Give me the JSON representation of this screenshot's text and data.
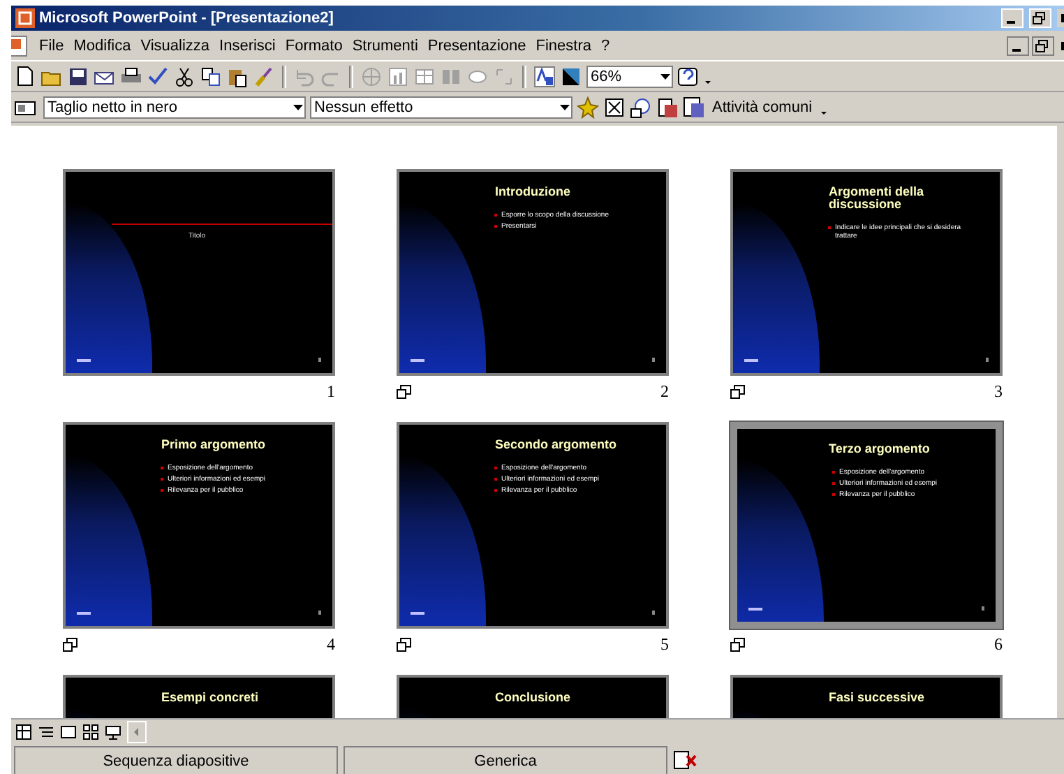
{
  "window": {
    "title": "Microsoft PowerPoint - [Presentazione2]"
  },
  "menu": [
    {
      "label": "File"
    },
    {
      "label": "Modifica"
    },
    {
      "label": "Visualizza"
    },
    {
      "label": "Inserisci"
    },
    {
      "label": "Formato"
    },
    {
      "label": "Strumenti"
    },
    {
      "label": "Presentazione"
    },
    {
      "label": "Finestra"
    },
    {
      "label": "?"
    }
  ],
  "standard_toolbar": {
    "zoom": "66%"
  },
  "sorter_toolbar": {
    "transition": "Taglio netto in nero",
    "effect": "Nessun effetto",
    "common_tasks": "Attività comuni"
  },
  "slides": [
    {
      "kind": "title",
      "number": "1",
      "text": "Titolo",
      "has_transition": false,
      "selected": false
    },
    {
      "kind": "content",
      "number": "2",
      "title": "Introduzione",
      "bullets": [
        "Esporre lo scopo della discussione",
        "Presentarsi"
      ],
      "has_transition": true,
      "selected": false
    },
    {
      "kind": "content",
      "number": "3",
      "title": "Argomenti della discussione",
      "bullets": [
        "Indicare le idee principali che si desidera trattare"
      ],
      "has_transition": true,
      "selected": false
    },
    {
      "kind": "content",
      "number": "4",
      "title": "Primo argomento",
      "bullets": [
        "Esposizione dell'argomento",
        "Ulteriori informazioni ed esempi",
        "Rilevanza per il pubblico"
      ],
      "has_transition": true,
      "selected": false
    },
    {
      "kind": "content",
      "number": "5",
      "title": "Secondo argomento",
      "bullets": [
        "Esposizione dell'argomento",
        "Ulteriori informazioni ed esempi",
        "Rilevanza per il pubblico"
      ],
      "has_transition": true,
      "selected": false
    },
    {
      "kind": "content",
      "number": "6",
      "title": "Terzo argomento",
      "bullets": [
        "Esposizione dell'argomento",
        "Ulteriori informazioni ed esempi",
        "Rilevanza per il pubblico"
      ],
      "has_transition": true,
      "selected": true
    },
    {
      "kind": "content",
      "title": "Esempi concreti",
      "selected": false
    },
    {
      "kind": "content",
      "title": "Conclusione",
      "selected": false
    },
    {
      "kind": "content",
      "title": "Fasi successive",
      "selected": false
    }
  ],
  "status_bar": [
    "Sequenza diapositive",
    "Generica"
  ]
}
